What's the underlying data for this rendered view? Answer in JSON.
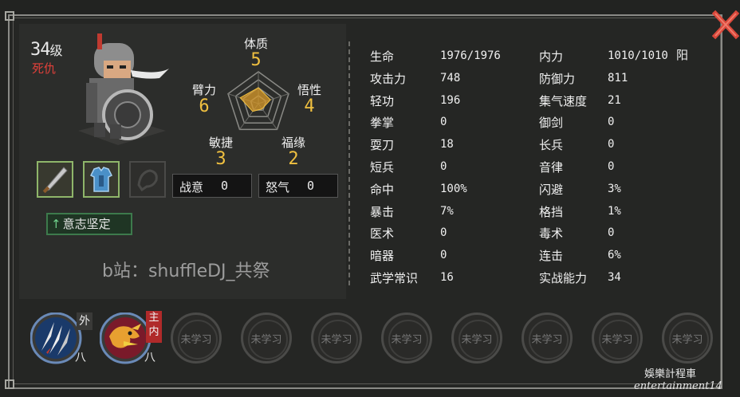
{
  "character": {
    "level_number": "34",
    "level_unit": "级",
    "status": "死仇"
  },
  "attributes": {
    "constitution": {
      "label": "体质",
      "value": "5"
    },
    "arm_strength": {
      "label": "臂力",
      "value": "6"
    },
    "insight": {
      "label": "悟性",
      "value": "4"
    },
    "agility": {
      "label": "敏捷",
      "value": "3"
    },
    "fortune": {
      "label": "福缘",
      "value": "2"
    }
  },
  "fight_boxes": {
    "battle_will": {
      "label": "战意",
      "value": "0"
    },
    "rage": {
      "label": "怒气",
      "value": "0"
    }
  },
  "equipment": [
    "sabre-icon",
    "armor-icon",
    "empty-slot-icon"
  ],
  "will_button": {
    "arrow": "↑",
    "label": "意志坚定"
  },
  "watermark": "b站：shuffleDJ_共祭",
  "stats_left": [
    {
      "label": "生命",
      "value": "1976/1976"
    },
    {
      "label": "攻击力",
      "value": "748"
    },
    {
      "label": "轻功",
      "value": "196"
    },
    {
      "label": "拳掌",
      "value": "0"
    },
    {
      "label": "耍刀",
      "value": "18"
    },
    {
      "label": "短兵",
      "value": "0"
    },
    {
      "label": "命中",
      "value": "100%"
    },
    {
      "label": "暴击",
      "value": "7%"
    },
    {
      "label": "医术",
      "value": "0"
    },
    {
      "label": "暗器",
      "value": "0"
    },
    {
      "label": "武学常识",
      "value": "16"
    }
  ],
  "stats_right": [
    {
      "label": "内力",
      "value": "1010/1010",
      "suffix": "阳"
    },
    {
      "label": "防御力",
      "value": "811"
    },
    {
      "label": "集气速度",
      "value": "21"
    },
    {
      "label": "御剑",
      "value": "0"
    },
    {
      "label": "长兵",
      "value": "0"
    },
    {
      "label": "音律",
      "value": "0"
    },
    {
      "label": "闪避",
      "value": "3%"
    },
    {
      "label": "格挡",
      "value": "1%"
    },
    {
      "label": "毒术",
      "value": "0"
    },
    {
      "label": "连击",
      "value": "6%"
    },
    {
      "label": "实战能力",
      "value": "34"
    }
  ],
  "skills": {
    "learned": [
      {
        "icon": "claw-icon",
        "tag": "外",
        "rank": "八"
      },
      {
        "icon": "dragon-icon",
        "tag": "主内",
        "rank": "八"
      }
    ],
    "empty_label": "未学习",
    "empty_slots": [
      "未学习",
      "未学习",
      "未学习",
      "未学习",
      "未学习",
      "未学习",
      "未学习",
      "未学习"
    ]
  },
  "footer": {
    "line1": "娛樂計程車",
    "line2": "entertainment14"
  },
  "colors": {
    "accent_gold": "#f0c040",
    "status_red": "#e0403a",
    "slot_green": "#8fb66a",
    "close_red": "#d9483b"
  }
}
